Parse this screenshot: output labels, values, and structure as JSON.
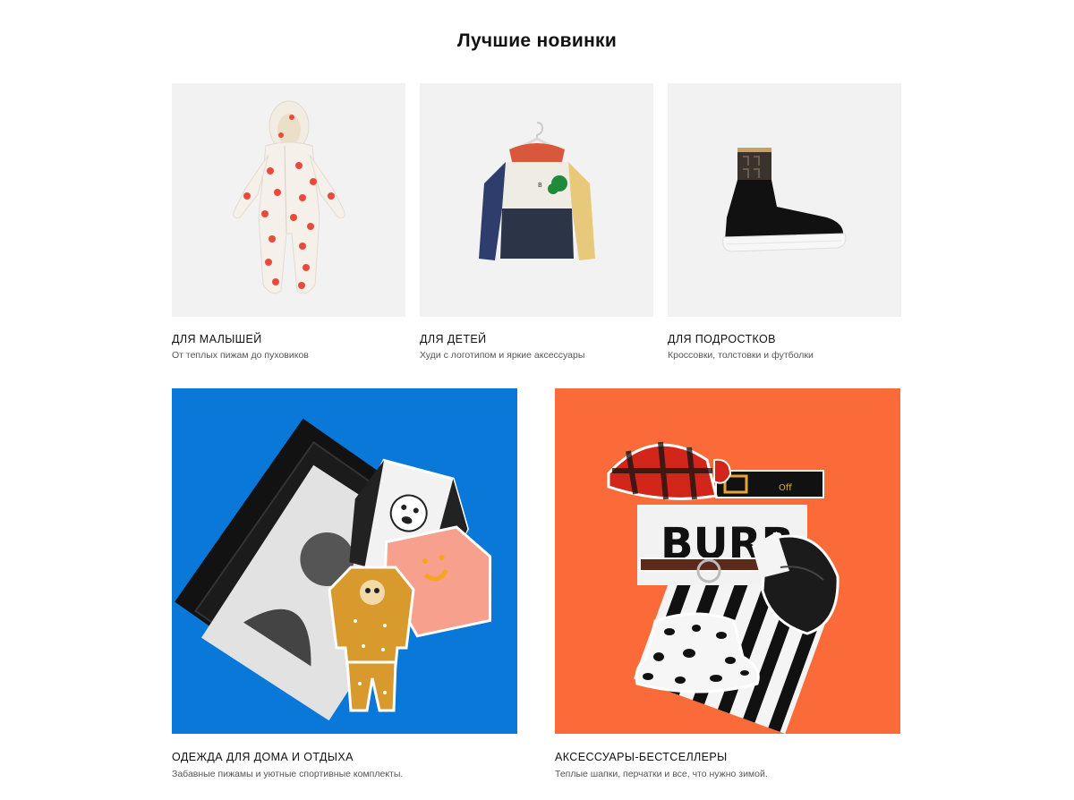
{
  "section": {
    "title": "Лучшие новинки"
  },
  "colors": {
    "tile_gray": "#f2f2f2",
    "blue_bg": "#0a78d8",
    "orange_bg": "#fb6b3a"
  },
  "cards": [
    {
      "title": "ДЛЯ МАЛЫШЕЙ",
      "subtitle": "От теплых пижам до пуховиков",
      "image": "baby-jumpsuit-image"
    },
    {
      "title": "ДЛЯ ДЕТЕЙ",
      "subtitle": "Худи с логотипом и яркие аксессуары",
      "image": "kids-hoodie-image"
    },
    {
      "title": "ДЛЯ ПОДРОСТКОВ",
      "subtitle": "Кроссовки, толстовки и футболки",
      "image": "sock-sneaker-image"
    },
    {
      "title": "ОДЕЖДА ДЛЯ ДОМА И ОТДЫХА",
      "subtitle": "Забавные пижамы и уютные спортивные комплекты.",
      "image": "homewear-collage-image"
    },
    {
      "title": "АКСЕССУАРЫ-БЕСТСЕЛЛЕРЫ",
      "subtitle": "Теплые шапки, перчатки и все, что нужно зимой.",
      "image": "accessories-collage-image"
    }
  ]
}
